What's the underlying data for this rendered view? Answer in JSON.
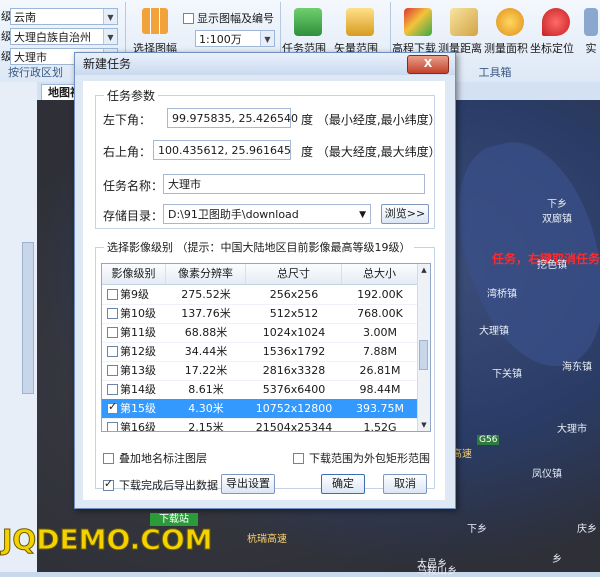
{
  "ribbon": {
    "region_dropdowns": [
      "云南",
      "大理白族自治州",
      "大理市"
    ],
    "region_side_chars": [
      "级",
      "级",
      "级"
    ],
    "region_group_label": "按行政区划",
    "select_frame_label": "选择图幅",
    "show_frame_label": "显示图幅及编号",
    "scale_value": "1:100万",
    "task_range_label": "任务范围",
    "vector_range_label": "矢量范围",
    "tools": [
      "高程下载",
      "测量距离",
      "测量面积",
      "坐标定位",
      "实"
    ],
    "tools_group_label": "工具箱"
  },
  "map_tab": "地图视",
  "map": {
    "hint": "任务，右键取消任务",
    "places": [
      "双廊镇",
      "挖色镇",
      "湾桥镇",
      "大理镇",
      "大理市",
      "下关镇",
      "海东镇",
      "凤仪镇",
      "下乡",
      "下乡",
      "庆乡",
      "乡",
      "太邑乡",
      "马鞍山乡",
      "杭瑞高速",
      "杭瑞高速"
    ],
    "road_badge": "G56"
  },
  "dialog": {
    "title": "新建任务",
    "close": "X",
    "params_legend": "任务参数",
    "lower_left_label": "左下角：",
    "lower_left_value": "99.975835, 25.426540",
    "lower_left_unit": "度 （最小经度,最小纬度）",
    "upper_right_label": "右上角：",
    "upper_right_value": "100.435612, 25.961645",
    "upper_right_unit": "度 （最大经度,最大纬度）",
    "task_name_label": "任务名称：",
    "task_name_value": "大理市",
    "save_dir_label": "存储目录：",
    "save_dir_value": "D:\\91卫图助手\\download",
    "browse": "浏览>>",
    "level_legend": "选择影像级别 （提示：中国大陆地区目前影像最高等级19级）",
    "columns": [
      "影像级别",
      "像素分辨率",
      "总尺寸",
      "总大小"
    ],
    "rows": [
      {
        "level": "第9级",
        "res": "275.52米",
        "size": "256x256",
        "total": "192.00K",
        "checked": false,
        "selected": false
      },
      {
        "level": "第10级",
        "res": "137.76米",
        "size": "512x512",
        "total": "768.00K",
        "checked": false,
        "selected": false
      },
      {
        "level": "第11级",
        "res": "68.88米",
        "size": "1024x1024",
        "total": "3.00M",
        "checked": false,
        "selected": false
      },
      {
        "level": "第12级",
        "res": "34.44米",
        "size": "1536x1792",
        "total": "7.88M",
        "checked": false,
        "selected": false
      },
      {
        "level": "第13级",
        "res": "17.22米",
        "size": "2816x3328",
        "total": "26.81M",
        "checked": false,
        "selected": false
      },
      {
        "level": "第14级",
        "res": "8.61米",
        "size": "5376x6400",
        "total": "98.44M",
        "checked": false,
        "selected": false
      },
      {
        "level": "第15级",
        "res": "4.30米",
        "size": "10752x12800",
        "total": "393.75M",
        "checked": true,
        "selected": true
      },
      {
        "level": "第16级",
        "res": "2.15米",
        "size": "21504x25344",
        "total": "1.52G",
        "checked": false,
        "selected": false
      }
    ],
    "overlay_label": "叠加地名标注图层",
    "bbox_label": "下载范围为外包矩形范围",
    "export_after_label": "下载完成后导出数据",
    "export_settings": "导出设置",
    "ok": "确定",
    "cancel": "取消"
  },
  "watermark": "JQDEMO.COM",
  "download_station": "下载站"
}
